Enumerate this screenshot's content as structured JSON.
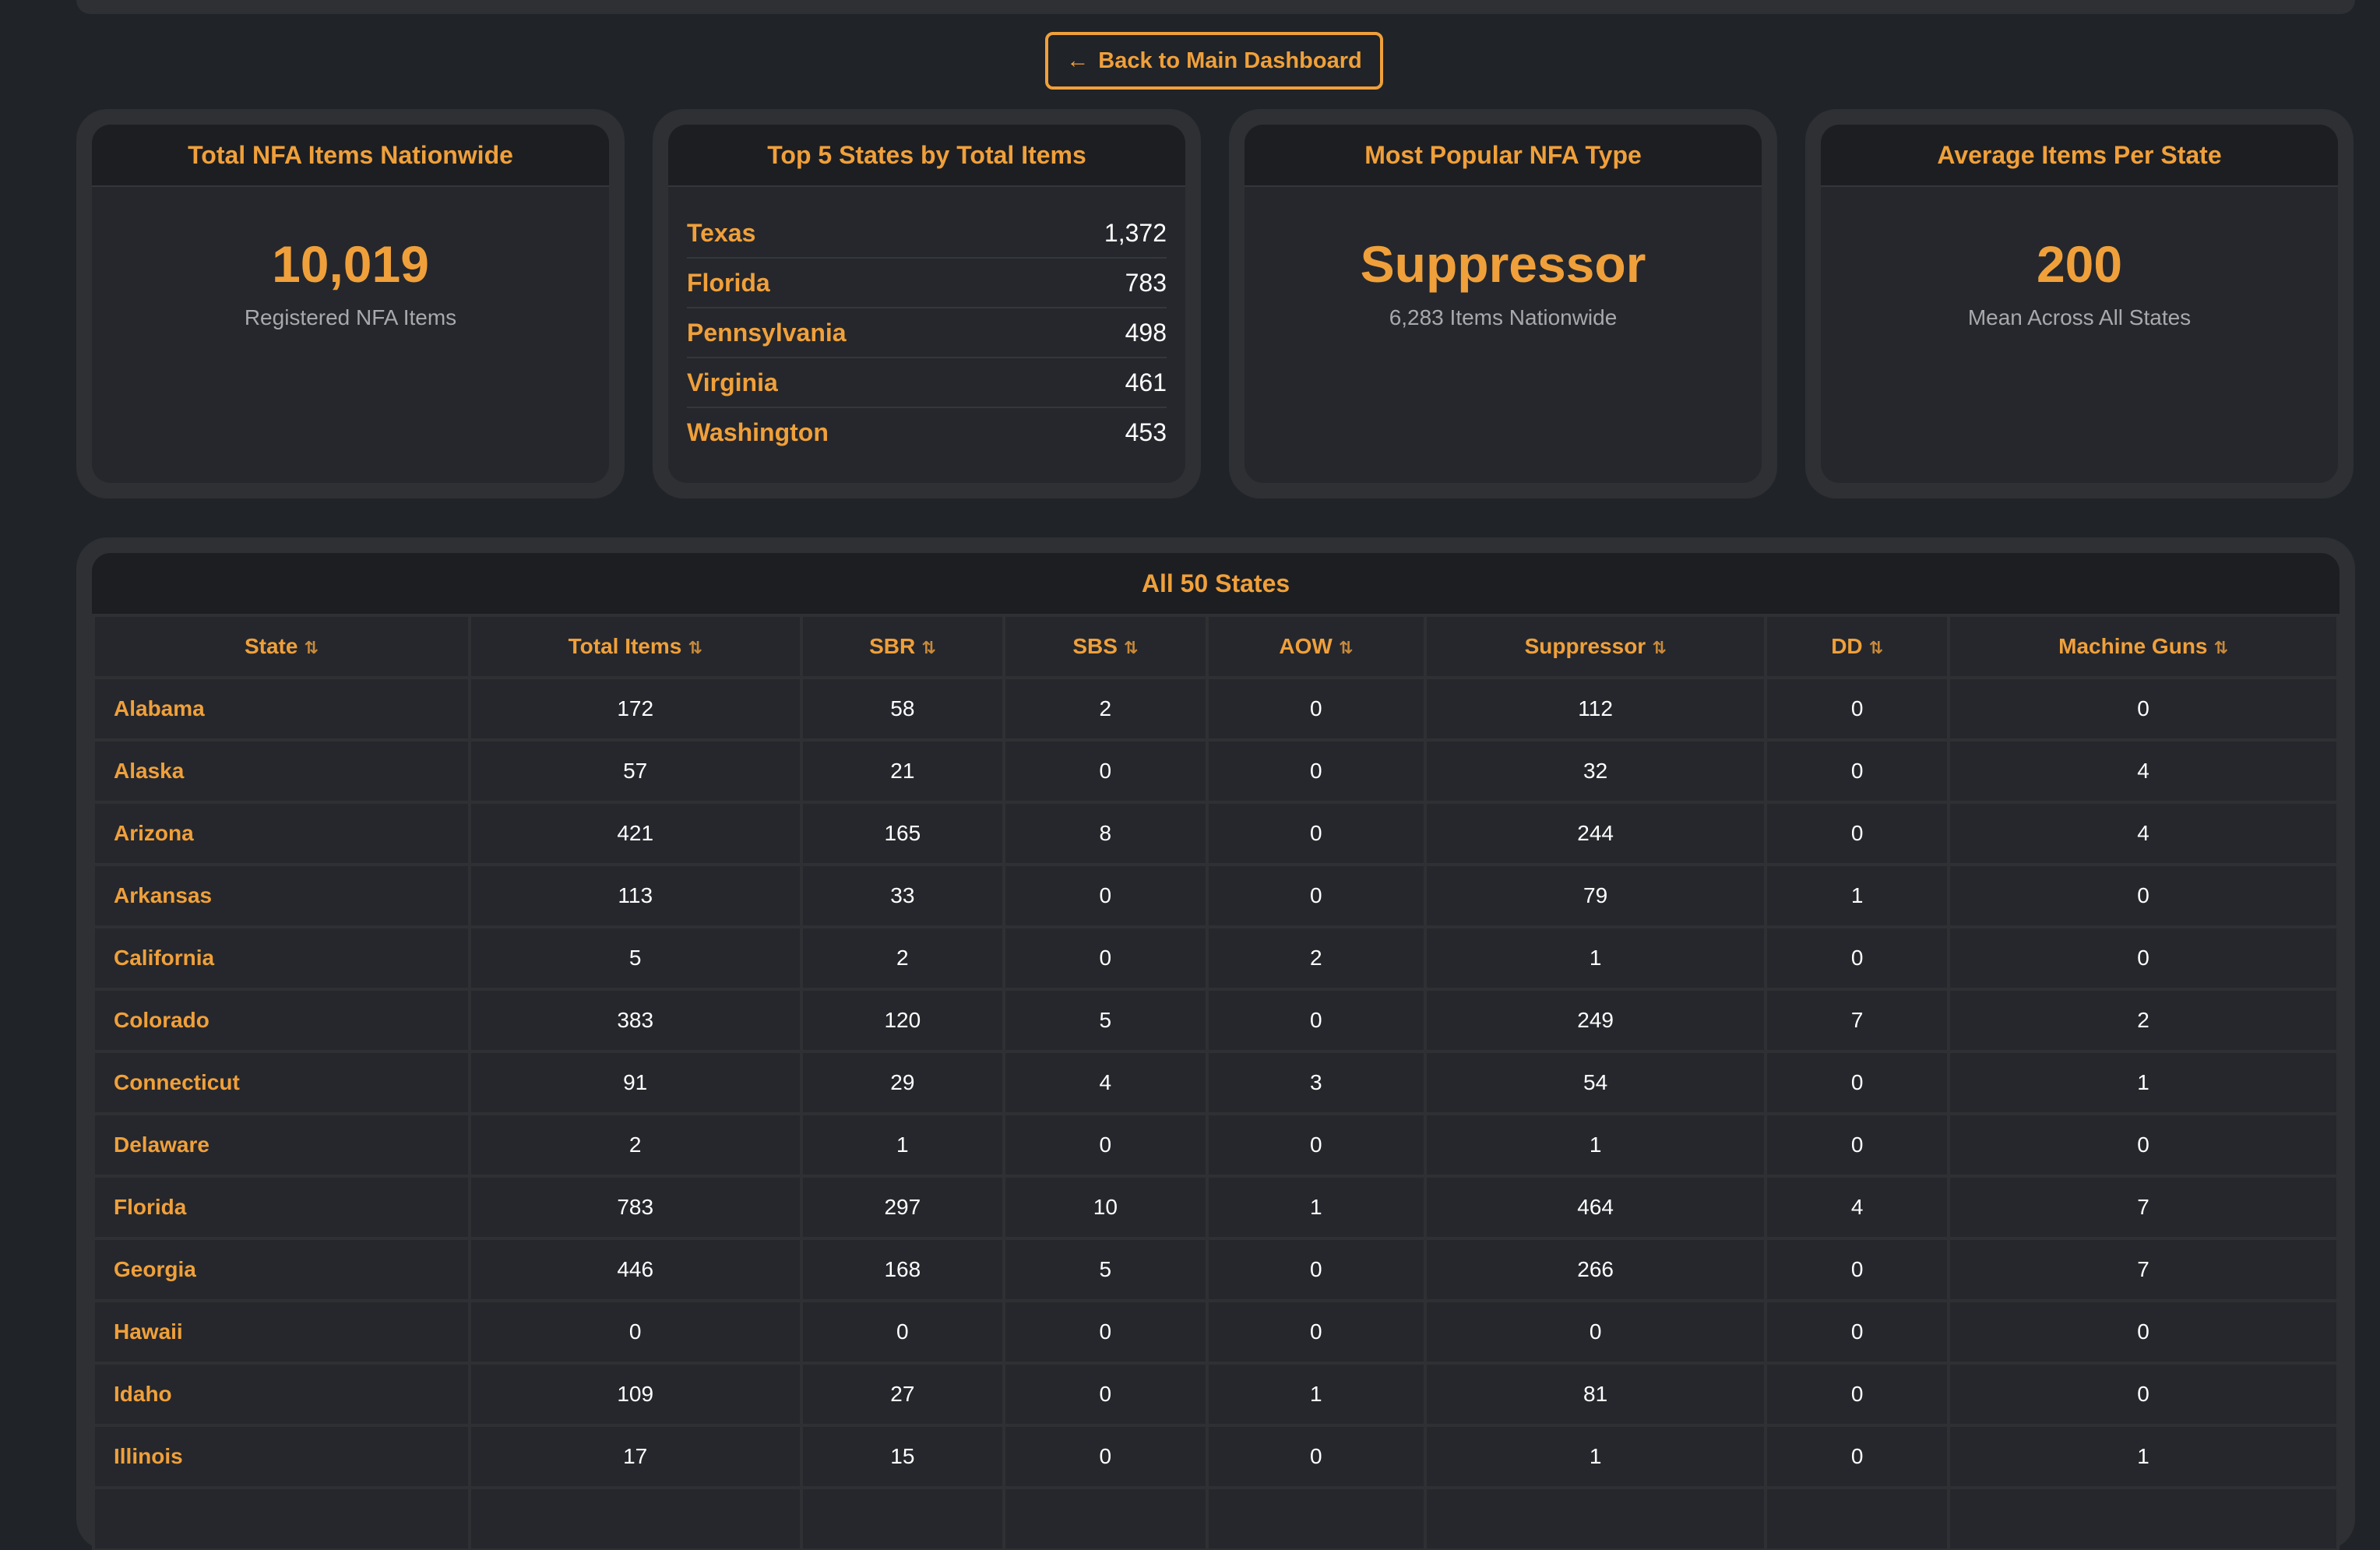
{
  "back_button": {
    "arrow": "←",
    "label": "Back to Main Dashboard"
  },
  "cards": {
    "total": {
      "title": "Total NFA Items Nationwide",
      "value": "10,019",
      "sub": "Registered NFA Items"
    },
    "top5": {
      "title": "Top 5 States by Total Items",
      "items": [
        {
          "state": "Texas",
          "value": "1,372"
        },
        {
          "state": "Florida",
          "value": "783"
        },
        {
          "state": "Pennsylvania",
          "value": "498"
        },
        {
          "state": "Virginia",
          "value": "461"
        },
        {
          "state": "Washington",
          "value": "453"
        }
      ]
    },
    "popular": {
      "title": "Most Popular NFA Type",
      "value": "Suppressor",
      "sub": "6,283 Items Nationwide"
    },
    "average": {
      "title": "Average Items Per State",
      "value": "200",
      "sub": "Mean Across All States"
    }
  },
  "table": {
    "title": "All 50 States",
    "sort_icon": "⇅",
    "columns": [
      "State",
      "Total Items",
      "SBR",
      "SBS",
      "AOW",
      "Suppressor",
      "DD",
      "Machine Guns"
    ],
    "rows": [
      [
        "Alabama",
        "172",
        "58",
        "2",
        "0",
        "112",
        "0",
        "0"
      ],
      [
        "Alaska",
        "57",
        "21",
        "0",
        "0",
        "32",
        "0",
        "4"
      ],
      [
        "Arizona",
        "421",
        "165",
        "8",
        "0",
        "244",
        "0",
        "4"
      ],
      [
        "Arkansas",
        "113",
        "33",
        "0",
        "0",
        "79",
        "1",
        "0"
      ],
      [
        "California",
        "5",
        "2",
        "0",
        "2",
        "1",
        "0",
        "0"
      ],
      [
        "Colorado",
        "383",
        "120",
        "5",
        "0",
        "249",
        "7",
        "2"
      ],
      [
        "Connecticut",
        "91",
        "29",
        "4",
        "3",
        "54",
        "0",
        "1"
      ],
      [
        "Delaware",
        "2",
        "1",
        "0",
        "0",
        "1",
        "0",
        "0"
      ],
      [
        "Florida",
        "783",
        "297",
        "10",
        "1",
        "464",
        "4",
        "7"
      ],
      [
        "Georgia",
        "446",
        "168",
        "5",
        "0",
        "266",
        "0",
        "7"
      ],
      [
        "Hawaii",
        "0",
        "0",
        "0",
        "0",
        "0",
        "0",
        "0"
      ],
      [
        "Idaho",
        "109",
        "27",
        "0",
        "1",
        "81",
        "0",
        "0"
      ],
      [
        "Illinois",
        "17",
        "15",
        "0",
        "0",
        "1",
        "0",
        "1"
      ],
      [
        "",
        "",
        "",
        "",
        "",
        "",
        "",
        ""
      ]
    ]
  },
  "colors": {
    "accent": "#f0a03a",
    "background": "#202328",
    "card": "#25272c",
    "card_border": "#2e3033"
  }
}
